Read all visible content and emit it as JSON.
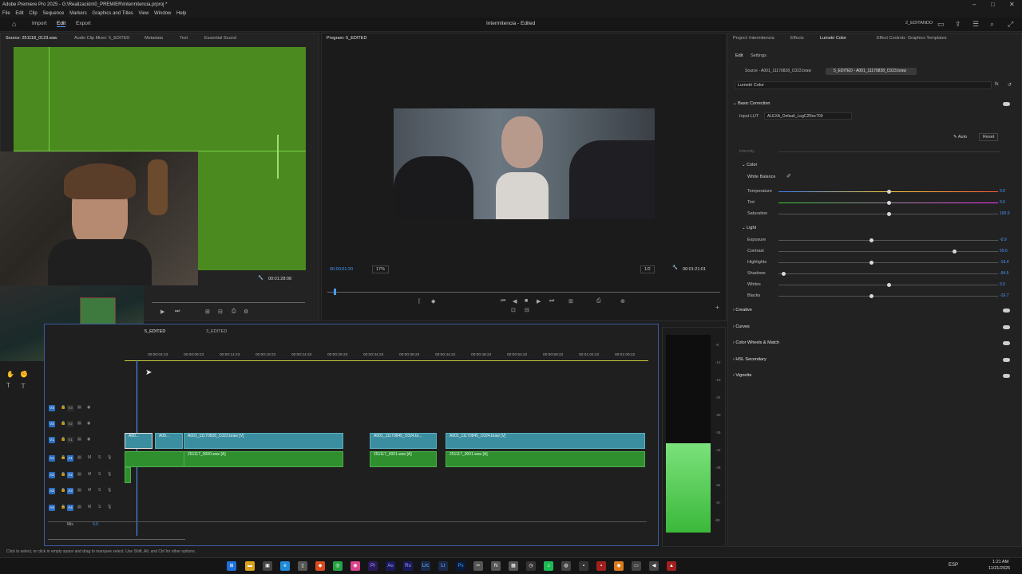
{
  "app": {
    "title": "Adobe Premiere Pro 2025 - G:\\Realización\\0_PREMIER\\Intermitencia.prproj *",
    "menu": [
      "File",
      "Edit",
      "Clip",
      "Sequence",
      "Markers",
      "Graphics and Titles",
      "View",
      "Window",
      "Help"
    ],
    "workspaces": {
      "import": "Import",
      "edit": "Edit",
      "export": "Export"
    },
    "project_title": "Intermitencia - Edited",
    "user_badge": "2_EDITANDO"
  },
  "source_panel": {
    "tabs": [
      "Source: 251118_0123.wav",
      "Audio Clip Mixer: 5_EDITED",
      "Metadata",
      "Text",
      "Essential Sound"
    ],
    "timecode": "00:01:28:08"
  },
  "program_panel": {
    "tab": "Program: 5_EDITED",
    "current_timecode": "00:00:01:20",
    "zoom": "17%",
    "resolution": "1/2",
    "duration": "00:01:21:01"
  },
  "lumetri": {
    "tabs": [
      "Project: Intermitencia",
      "Effects",
      "Lumetri Color",
      "Effect Controls",
      "Graphics Templates"
    ],
    "subtabs": [
      "Edit",
      "Settings"
    ],
    "source_chip": "Source - A001_11170828_C023.braw",
    "sequence_chip": "5_EDITED - A001_11170828_C023.braw",
    "effect_name": "Lumetri Color",
    "basic_correction": "Basic Correction",
    "input_lut_label": "Input LUT",
    "input_lut_value": "ALEXA_Default_LogC2Rec709",
    "auto": "Auto",
    "reset": "Reset",
    "intensity_label": "Intensity",
    "color_section": "Color",
    "white_balance": "White Balance",
    "color_rows": [
      {
        "label": "Temperature",
        "value": "0.0",
        "pos": 0.5
      },
      {
        "label": "Tint",
        "value": "0.0",
        "pos": 0.5
      },
      {
        "label": "Saturation",
        "value": "100.0",
        "pos": 0.5
      }
    ],
    "light_section": "Light",
    "light_rows": [
      {
        "label": "Exposure",
        "value": "-0.9",
        "pos": 0.42
      },
      {
        "label": "Contrast",
        "value": "59.6",
        "pos": 0.8
      },
      {
        "label": "Highlights",
        "value": "-16.4",
        "pos": 0.42
      },
      {
        "label": "Shadows",
        "value": "-94.5",
        "pos": 0.02
      },
      {
        "label": "Whites",
        "value": "0.0",
        "pos": 0.5
      },
      {
        "label": "Blacks",
        "value": "-16.7",
        "pos": 0.42
      }
    ],
    "sections": [
      "Creative",
      "Curves",
      "Color Wheels & Match",
      "HSL Secondary",
      "Vignette"
    ]
  },
  "timeline": {
    "tabs": [
      "5_EDITED",
      "3_EDITED"
    ],
    "ruler": [
      "00:00:04:23",
      "00:00:09:23",
      "00:00:14:23",
      "00:00:19:23",
      "00:00:24:23",
      "00:00:29:23",
      "00:00:34:23",
      "00:00:39:23",
      "00:00:44:22",
      "00:00:49:22",
      "00:00:54:22",
      "00:00:59:22",
      "00:01:04:22",
      "00:01:09:22"
    ],
    "video_tracks": [
      "V3",
      "V2",
      "V1"
    ],
    "audio_tracks": [
      "A1",
      "A2",
      "A3",
      "A4"
    ],
    "mix_label": "Mix",
    "mix_value": "0.0",
    "clips": {
      "v1_a": "A00...",
      "v1_b": "A00...",
      "v1_c": "A001_11170828_C023.braw [V]",
      "v1_d": "A001_11170845_C024.br...",
      "v1_e": "A001_11170845_C024.braw [V]",
      "a1_a": "251117_0000.wav [A]",
      "a1_b": "251117_0001.wav [A]",
      "a1_c": "251117_0001.wav [A]"
    }
  },
  "meter_scale": [
    "-6",
    "-12",
    "-18",
    "-24",
    "-30",
    "-36",
    "-42",
    "-48",
    "-54",
    "-57",
    "dB"
  ],
  "meter_level": 0.45,
  "status_text": "Click to select, or click in empty space and drag to marquee select. Use Shift, Alt, and Ctrl for other options.",
  "taskbar": {
    "lang": "ESP",
    "time": "1:21 AM",
    "date": "11/21/2025"
  },
  "colors": {
    "accent": "#2b6fc2",
    "audio_clip": "#2f8f2f",
    "video_clip": "#3b8ea0",
    "source_bg": "#4a8a1e",
    "playhead": "#4a9bff"
  }
}
